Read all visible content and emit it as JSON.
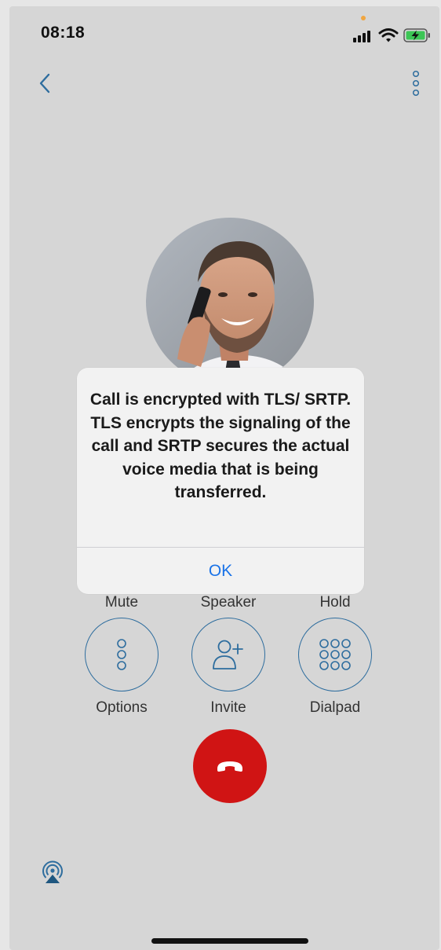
{
  "status_bar": {
    "time": "08:18"
  },
  "nav": {
    "back_icon": "chevron-left-icon",
    "menu_icon": "vertical-dots-icon"
  },
  "contact": {
    "avatar": "caller-photo"
  },
  "controls": {
    "top_row": [
      {
        "label": "Mute"
      },
      {
        "label": "Speaker"
      },
      {
        "label": "Hold"
      }
    ],
    "bottom_row": [
      {
        "label": "Options",
        "icon": "vertical-dots-icon"
      },
      {
        "label": "Invite",
        "icon": "add-person-icon"
      },
      {
        "label": "Dialpad",
        "icon": "dialpad-icon"
      }
    ]
  },
  "hangup": {
    "icon": "hangup-phone-icon"
  },
  "airplay": {
    "icon": "airplay-icon"
  },
  "alert": {
    "message": "Call is encrypted with TLS/ SRTP. TLS encrypts the signaling of the call and SRTP secures the actual voice media that is being transferred.",
    "ok_label": "OK"
  },
  "colors": {
    "accent": "#2e6d9e",
    "hangup": "#d01414",
    "alert_button": "#1a73e8",
    "background": "#d6d6d6"
  }
}
